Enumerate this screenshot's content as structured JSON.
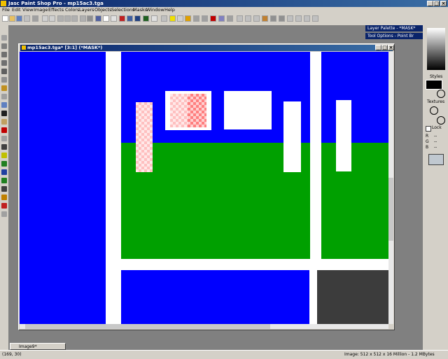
{
  "app": {
    "title": "Jasc Paint Shop Pro - mp15ac3.tga"
  },
  "menu": [
    "File",
    "Edit",
    "View",
    "Image",
    "Effects",
    "Colors",
    "Layers",
    "Objects",
    "Selections",
    "Masks",
    "Window",
    "Help"
  ],
  "document": {
    "title": "mp15ac3.tga* [3:1] (*MASK*)"
  },
  "palettes": {
    "layer": "Layer Palette - *MASK*",
    "tool_options": "Tool Options - Point Br"
  },
  "right_panel": {
    "styles": "Styles",
    "textures": "Textures",
    "lock": "Lock",
    "r": "R",
    "g": "G",
    "b": "B",
    "r_val": "--",
    "g_val": "--",
    "b_val": "--"
  },
  "minimized": {
    "title": "Image9*"
  },
  "status": {
    "coords": "(169, 30)",
    "image_info": "Image: 512 x 512 x 16 Million - 1.2 MBytes"
  },
  "colors": {
    "canvas_blue": "#0000ff",
    "canvas_green": "#00a000",
    "white": "#ffffff",
    "texture": "#3c3c3c"
  }
}
